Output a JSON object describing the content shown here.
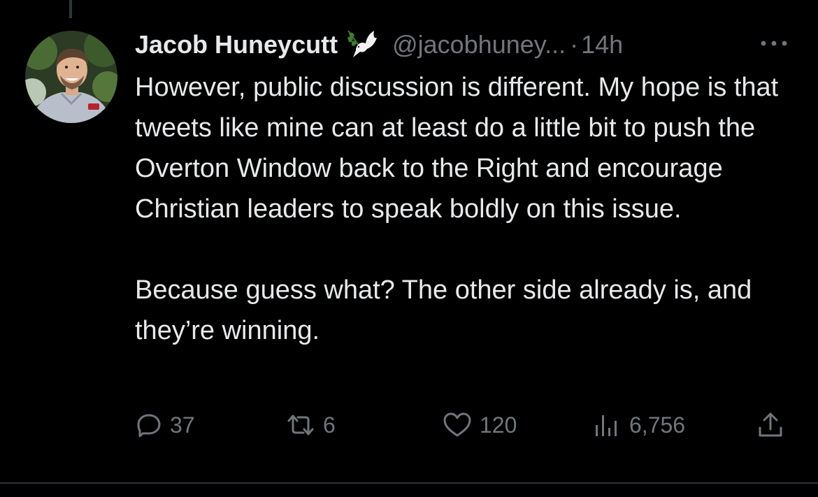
{
  "tweet": {
    "author": {
      "display_name": "Jacob Huneycutt",
      "badge_icon": "dove-icon",
      "handle": "@jacobhuney...",
      "separator": "·",
      "timestamp": "14h"
    },
    "body": [
      "However, public discussion is different. My hope is that tweets like mine can at least do a little bit to push the Overton Window back to the Right and encourage Christian leaders to speak boldly on this issue.",
      "Because guess what? The other side already is, and they’re winning."
    ],
    "actions": {
      "replies": "37",
      "retweets": "6",
      "likes": "120",
      "views": "6,756"
    }
  },
  "colors": {
    "background": "#000000",
    "text_primary": "#e7e9ea",
    "text_secondary": "#71767b",
    "divider": "#2f3336"
  }
}
